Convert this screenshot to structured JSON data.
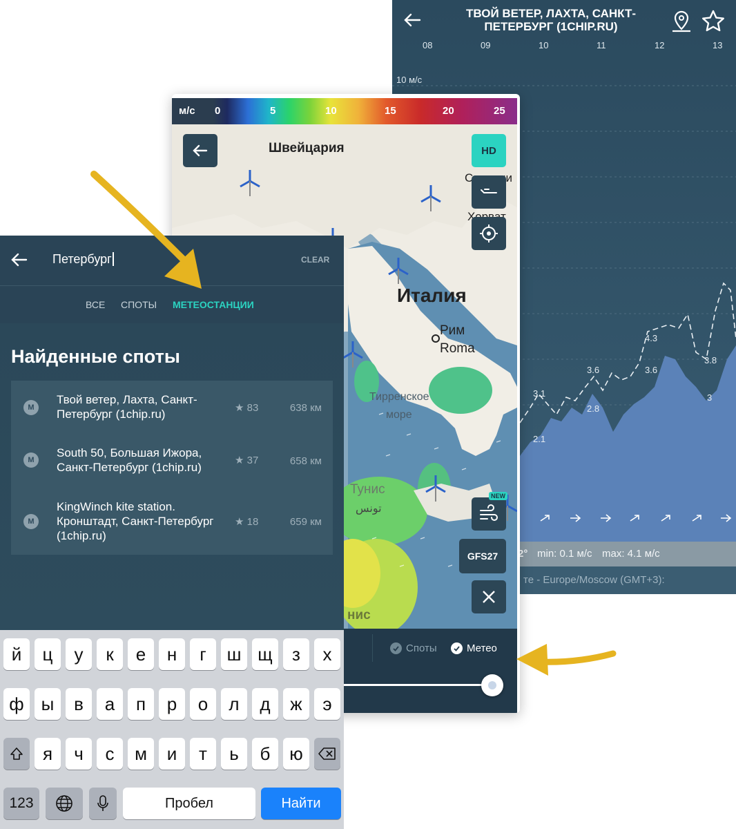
{
  "chart_screen": {
    "title": "ТВОЙ ВЕТЕР, ЛАХТА, САНКТ-ПЕТЕРБУРГ (1CHIP.RU)",
    "hours": [
      "08",
      "09",
      "10",
      "11",
      "12",
      "13"
    ],
    "unit_label": "10 м/с",
    "point_labels": [
      "2.1",
      "3.1",
      "2.8",
      "3.6",
      "4.3",
      "3.6",
      "3.8",
      "3"
    ],
    "stats": {
      "partial": "2°",
      "min": "min: 0.1 м/с",
      "max": "max: 4.1 м/с"
    },
    "timezone": "те - Europe/Moscow (GMT+3):",
    "colors": {
      "background": "#2b4a5e",
      "area": "#5b82b8"
    }
  },
  "map_screen": {
    "legend": {
      "unit": "м/с",
      "ticks": [
        "0",
        "5",
        "10",
        "15",
        "20",
        "25"
      ]
    },
    "hd_label": "HD",
    "new_badge": "NEW",
    "model_button": "GFS27",
    "labels": {
      "switzerland": "Швейцария",
      "slovenia": "Словени",
      "croatia": "Хорват",
      "italy": "Италия",
      "rome_ru": "Рим",
      "rome": "Roma",
      "tyrrhenian": "Тирренское",
      "sea": "море",
      "tunis": "Тунис",
      "tunis_ar": "تونس",
      "tunis_short": "нис"
    },
    "filters": [
      {
        "label": "Споты",
        "checked": true
      },
      {
        "label": "Метео",
        "checked": true
      }
    ],
    "slider_value": 1,
    "colors": {
      "accent": "#2bd3c1",
      "panel": "#22394a"
    }
  },
  "search_screen": {
    "query": "Петербург",
    "clear_label": "CLEAR",
    "tabs": [
      {
        "label": "ВСЕ",
        "active": false
      },
      {
        "label": "СПОТЫ",
        "active": false
      },
      {
        "label": "МЕТЕОСТАНЦИИ",
        "active": true
      }
    ],
    "section_title": "Найденные споты",
    "results": [
      {
        "badge": "M",
        "name": "Твой ветер, Лахта, Санкт-Петербург (1chip.ru)",
        "rating": "83",
        "distance": "638 км"
      },
      {
        "badge": "M",
        "name": "South 50, Большая Ижора, Санкт-Петербург (1chip.ru)",
        "rating": "37",
        "distance": "658 км"
      },
      {
        "badge": "M",
        "name": "KingWinch kite station. Кронштадт, Санкт-Петербург (1chip.ru)",
        "rating": "18",
        "distance": "659 км"
      }
    ],
    "keyboard": {
      "row1": [
        "й",
        "ц",
        "у",
        "к",
        "е",
        "н",
        "г",
        "ш",
        "щ",
        "з",
        "х"
      ],
      "row2": [
        "ф",
        "ы",
        "в",
        "а",
        "п",
        "р",
        "о",
        "л",
        "д",
        "ж",
        "э"
      ],
      "row3": [
        "я",
        "ч",
        "с",
        "м",
        "и",
        "т",
        "ь",
        "б",
        "ю"
      ],
      "numbers": "123",
      "space": "Пробел",
      "submit": "Найти"
    },
    "colors": {
      "accent": "#2bd3c1",
      "submit": "#1a82fb"
    }
  }
}
